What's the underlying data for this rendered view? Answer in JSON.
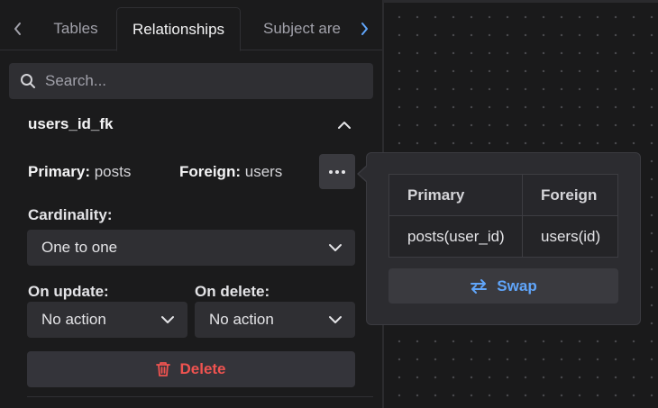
{
  "tabs": {
    "items": [
      "Tables",
      "Relationships",
      "Subject are"
    ],
    "active": "Relationships"
  },
  "search": {
    "placeholder": "Search..."
  },
  "relationship": {
    "name": "users_id_fk",
    "primary_label": "Primary:",
    "primary_value": "posts",
    "foreign_label": "Foreign:",
    "foreign_value": "users",
    "cardinality_label": "Cardinality:",
    "cardinality_value": "One to one",
    "on_update_label": "On update:",
    "on_update_value": "No action",
    "on_delete_label": "On delete:",
    "on_delete_value": "No action",
    "delete_label": "Delete"
  },
  "popover": {
    "headers": [
      "Primary",
      "Foreign"
    ],
    "row": [
      "posts(user_id)",
      "users(id)"
    ],
    "swap_label": "Swap"
  },
  "colors": {
    "accent": "#60a5fa",
    "danger": "#ef5350",
    "background": "#1b1b1c",
    "surface": "#2f2f33"
  },
  "icons": {
    "tab_prev": "chevron-left-icon",
    "tab_next": "chevron-right-icon",
    "search": "search-icon",
    "collapse": "chevron-up-icon",
    "more": "more-horizontal-icon",
    "select": "chevron-down-icon",
    "delete": "trash-icon",
    "swap": "swap-arrows-icon"
  }
}
